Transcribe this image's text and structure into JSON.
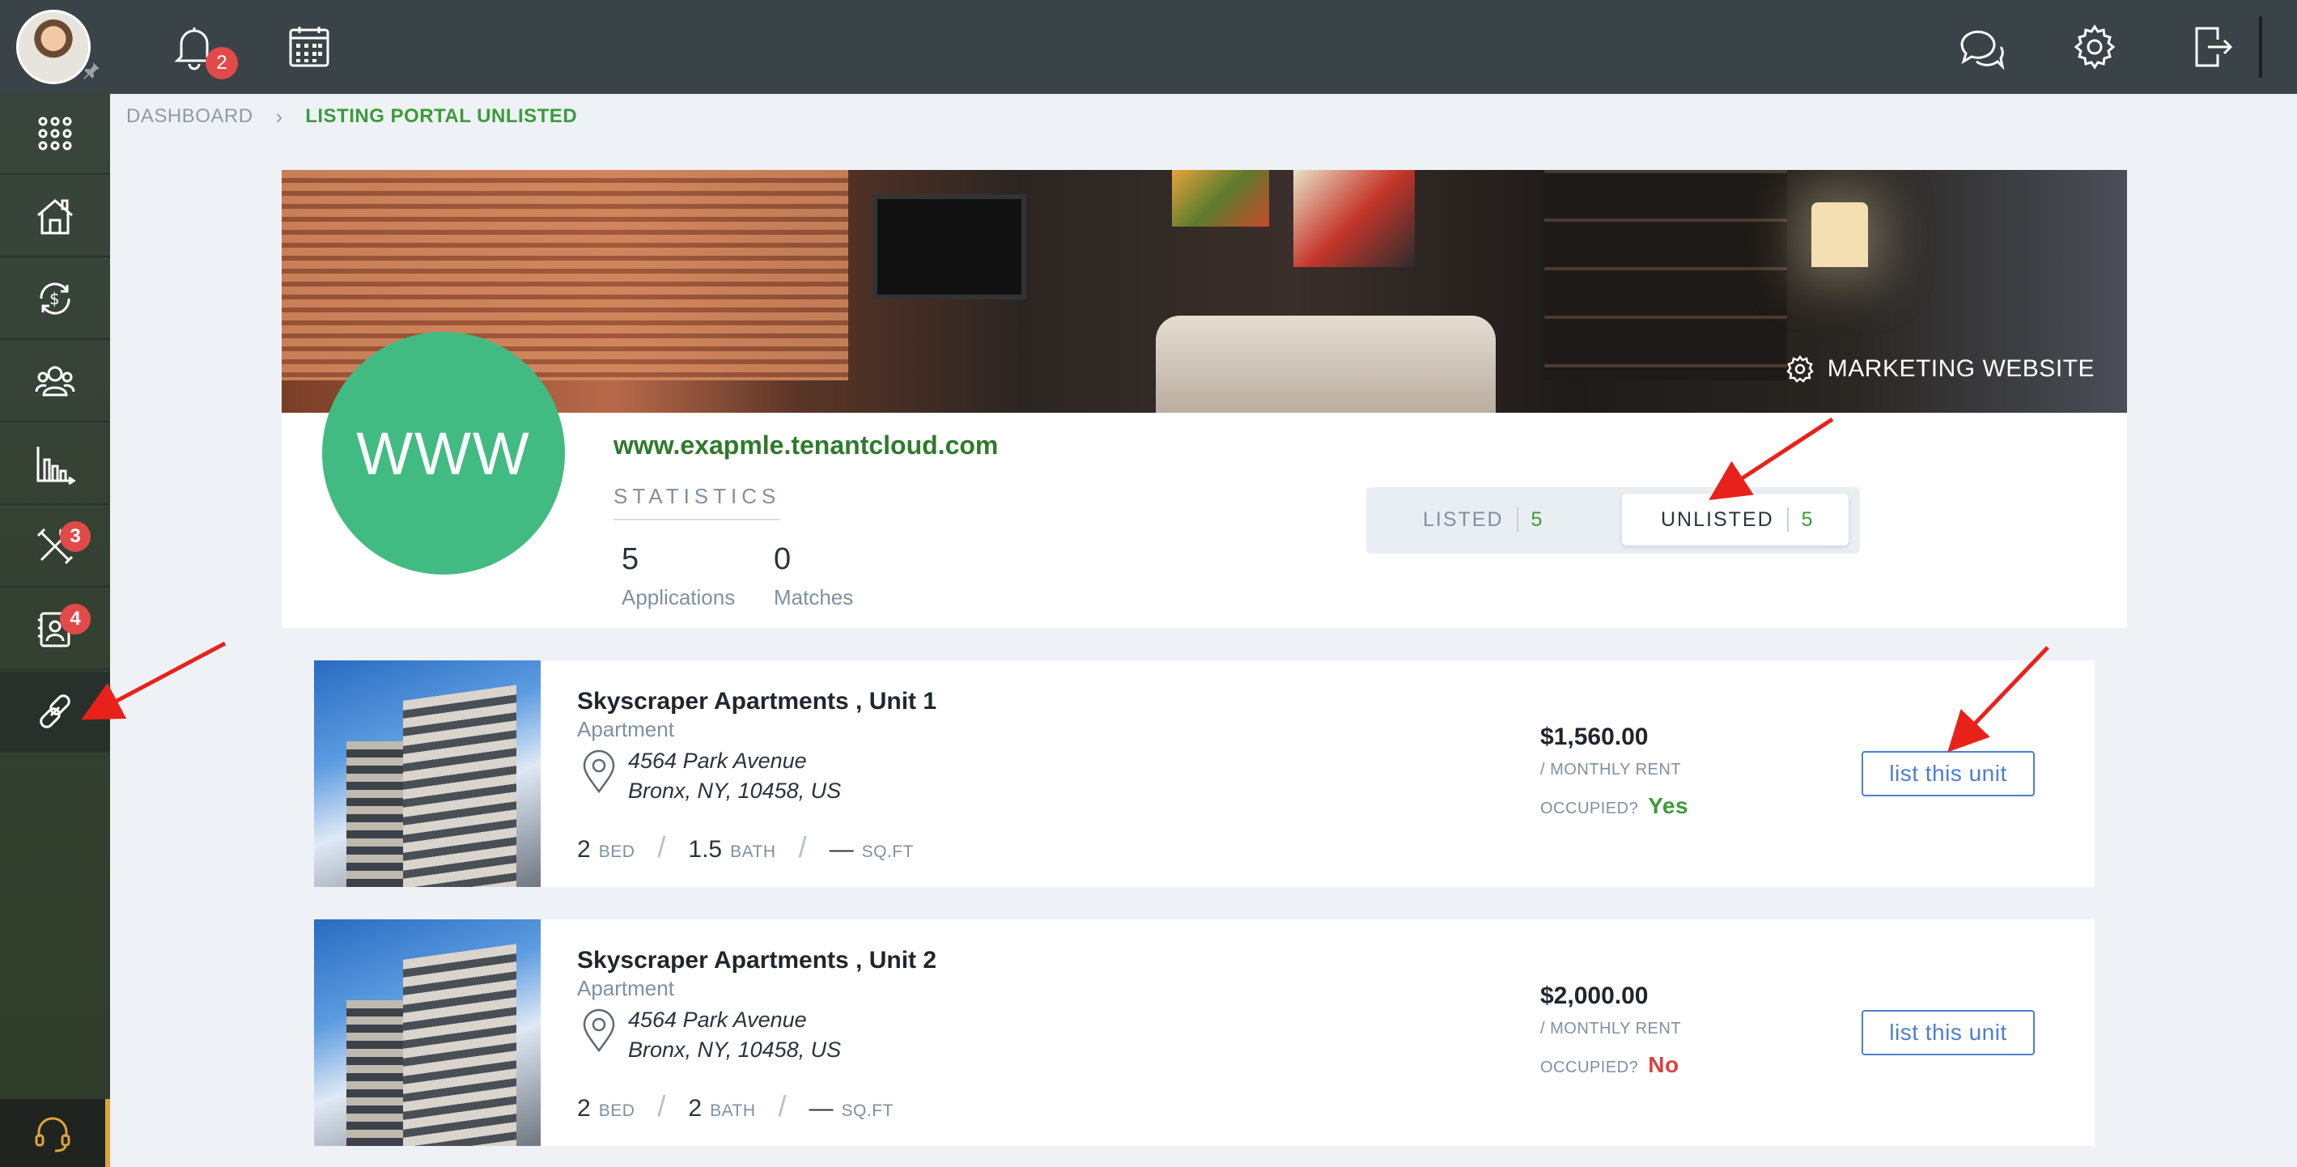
{
  "topbar": {
    "notifications_count": "2",
    "icons": [
      "bell-icon",
      "calendar-icon",
      "chat-icon",
      "gear-icon",
      "logout-icon"
    ]
  },
  "sidebar": {
    "items": [
      {
        "name": "apps-grid",
        "badge": ""
      },
      {
        "name": "properties",
        "badge": ""
      },
      {
        "name": "accounting",
        "badge": ""
      },
      {
        "name": "contacts",
        "badge": ""
      },
      {
        "name": "reports",
        "badge": ""
      },
      {
        "name": "maintenance",
        "badge": "3"
      },
      {
        "name": "applications",
        "badge": "4"
      },
      {
        "name": "listing",
        "badge": ""
      }
    ]
  },
  "breadcrumb": {
    "home": "DASHBOARD",
    "current": "LISTING PORTAL UNLISTED"
  },
  "portal": {
    "marketing_label": "MARKETING WEBSITE",
    "logo_text": "WWW",
    "site_url": "www.exapmle.tenantcloud.com",
    "statistics_label": "STATISTICS",
    "applications_count": "5",
    "applications_label": "Applications",
    "matches_count": "0",
    "matches_label": "Matches",
    "tabs": [
      {
        "label": "LISTED",
        "count": "5",
        "active": false
      },
      {
        "label": "UNLISTED",
        "count": "5",
        "active": true
      }
    ]
  },
  "listings": [
    {
      "title": "Skyscraper Apartments , Unit 1",
      "type": "Apartment",
      "address_line1": "4564 Park Avenue",
      "address_line2": "Bronx, NY, 10458, US",
      "beds": "2",
      "beds_unit": "BED",
      "baths": "1.5",
      "baths_unit": "BATH",
      "sqft": "—",
      "sqft_unit": "SQ.FT",
      "price": "$1,560.00",
      "rent_label": "/ MONTHLY RENT",
      "occupied_label": "OCCUPIED?",
      "occupied_value": "Yes",
      "button_label": "list this unit"
    },
    {
      "title": "Skyscraper Apartments , Unit 2",
      "type": "Apartment",
      "address_line1": "4564 Park Avenue",
      "address_line2": "Bronx, NY, 10458, US",
      "beds": "2",
      "beds_unit": "BED",
      "baths": "2",
      "baths_unit": "BATH",
      "sqft": "—",
      "sqft_unit": "SQ.FT",
      "price": "$2,000.00",
      "rent_label": "/ MONTHLY RENT",
      "occupied_label": "OCCUPIED?",
      "occupied_value": "No",
      "button_label": "list this unit"
    }
  ],
  "colors": {
    "accent_green": "#3d9a3a",
    "badge_red": "#e24a4a",
    "button_blue": "#4d7fcf",
    "annotation_red": "#e8221b"
  }
}
